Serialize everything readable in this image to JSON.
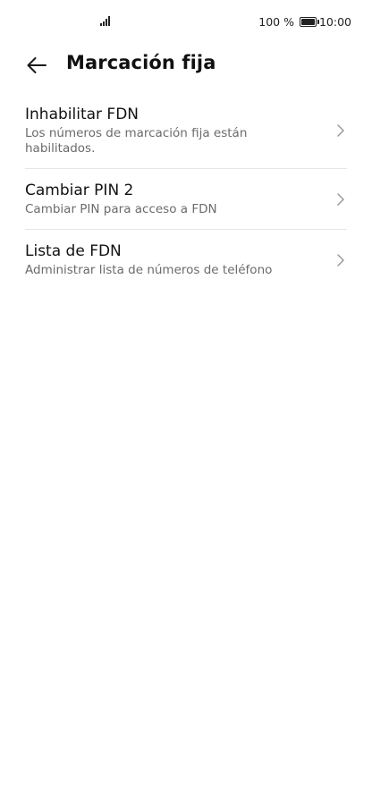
{
  "status_bar": {
    "battery_text": "100 %",
    "time": "10:00",
    "icons": [
      "signal-icon",
      "battery-icon"
    ]
  },
  "header": {
    "back_icon": "back-arrow-icon",
    "title": "Marcación fija"
  },
  "items": [
    {
      "title": "Inhabilitar FDN",
      "subtitle": "Los números de marcación fija están habilitados.",
      "icon": "chevron-right-icon"
    },
    {
      "title": "Cambiar PIN 2",
      "subtitle": "Cambiar PIN para acceso a FDN",
      "icon": "chevron-right-icon"
    },
    {
      "title": "Lista de FDN",
      "subtitle": "Administrar lista de números de teléfono",
      "icon": "chevron-right-icon"
    }
  ]
}
